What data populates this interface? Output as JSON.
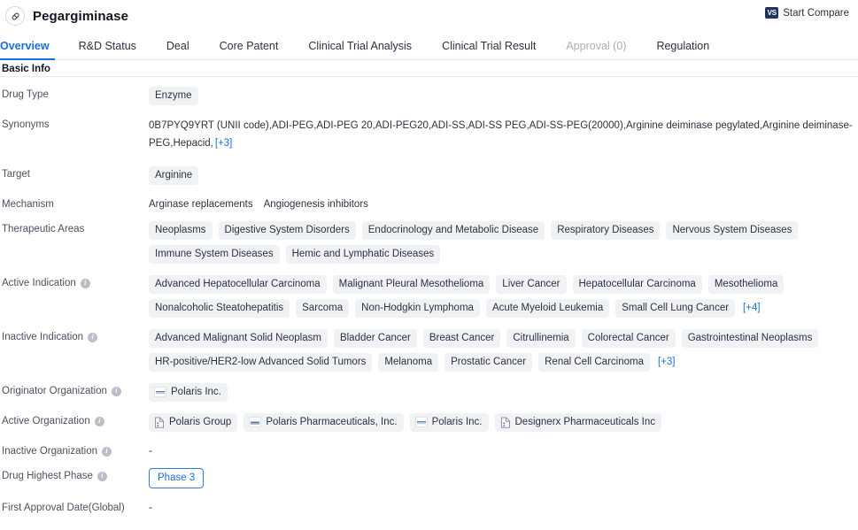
{
  "header": {
    "title": "Pegargiminase",
    "drug_icon": "capsule-icon",
    "compare_label": "Start Compare",
    "compare_badge": "VS"
  },
  "tabs": [
    {
      "label": "Overview",
      "state": "active"
    },
    {
      "label": "R&D Status",
      "state": "normal"
    },
    {
      "label": "Deal",
      "state": "normal"
    },
    {
      "label": "Core Patent",
      "state": "normal"
    },
    {
      "label": "Clinical Trial Analysis",
      "state": "normal"
    },
    {
      "label": "Clinical Trial Result",
      "state": "normal"
    },
    {
      "label": "Approval (0)",
      "state": "disabled"
    },
    {
      "label": "Regulation",
      "state": "normal"
    }
  ],
  "section": {
    "basic_info_title": "Basic Info"
  },
  "rows": {
    "drug_type": {
      "label": "Drug Type",
      "chips": [
        "Enzyme"
      ]
    },
    "synonyms": {
      "label": "Synonyms",
      "text": "0B7PYQ9YRT (UNII code),ADI-PEG,ADI-PEG 20,ADI-PEG20,ADI-SS,ADI-SS PEG,ADI-SS-PEG(20000),Arginine deiminase pegylated,Arginine deiminase-PEG,Hepacid,",
      "more": "[+3]"
    },
    "target": {
      "label": "Target",
      "chips": [
        "Arginine"
      ]
    },
    "mechanism": {
      "label": "Mechanism",
      "items": [
        "Arginase replacements",
        "Angiogenesis inhibitors"
      ]
    },
    "therapeutic_areas": {
      "label": "Therapeutic Areas",
      "chips": [
        "Neoplasms",
        "Digestive System Disorders",
        "Endocrinology and Metabolic Disease",
        "Respiratory Diseases",
        "Nervous System Diseases",
        "Immune System Diseases",
        "Hemic and Lymphatic Diseases"
      ]
    },
    "active_indication": {
      "label": "Active Indication",
      "info": "i",
      "chips": [
        "Advanced Hepatocellular Carcinoma",
        "Malignant Pleural Mesothelioma",
        "Liver Cancer",
        "Hepatocellular Carcinoma",
        "Mesothelioma",
        "Nonalcoholic Steatohepatitis",
        "Sarcoma",
        "Non-Hodgkin Lymphoma",
        "Acute Myeloid Leukemia",
        "Small Cell Lung Cancer"
      ],
      "more": "[+4]"
    },
    "inactive_indication": {
      "label": "Inactive Indication",
      "info": "i",
      "chips": [
        "Advanced Malignant Solid Neoplasm",
        "Bladder Cancer",
        "Breast Cancer",
        "Citrullinemia",
        "Colorectal Cancer",
        "Gastrointestinal Neoplasms",
        "HR-positive/HER2-low Advanced Solid Tumors",
        "Melanoma",
        "Prostatic Cancer",
        "Renal Cell Carcinoma"
      ],
      "more": "[+3]"
    },
    "originator_organization": {
      "label": "Originator Organization",
      "info": "i",
      "orgs": [
        {
          "name": "Polaris Inc.",
          "icon": "company-logo-icon"
        }
      ]
    },
    "active_organization": {
      "label": "Active Organization",
      "info": "i",
      "orgs": [
        {
          "name": "Polaris Group",
          "icon": "company-building-icon"
        },
        {
          "name": "Polaris Pharmaceuticals, Inc.",
          "icon": "company-logo-icon"
        },
        {
          "name": "Polaris Inc.",
          "icon": "company-logo-icon"
        },
        {
          "name": "Designerx Pharmaceuticals Inc",
          "icon": "company-building-icon"
        }
      ]
    },
    "inactive_organization": {
      "label": "Inactive Organization",
      "info": "i",
      "empty": "-"
    },
    "drug_highest_phase": {
      "label": "Drug Highest Phase",
      "info": "i",
      "badge": "Phase 3"
    },
    "first_approval_date": {
      "label": "First Approval Date(Global)",
      "empty": "-"
    }
  },
  "colors": {
    "accent": "#1a6fe0",
    "chip_bg": "#f1f2f5",
    "text": "#2b3240",
    "label": "#4a5160",
    "badge_navy": "#22335c"
  }
}
